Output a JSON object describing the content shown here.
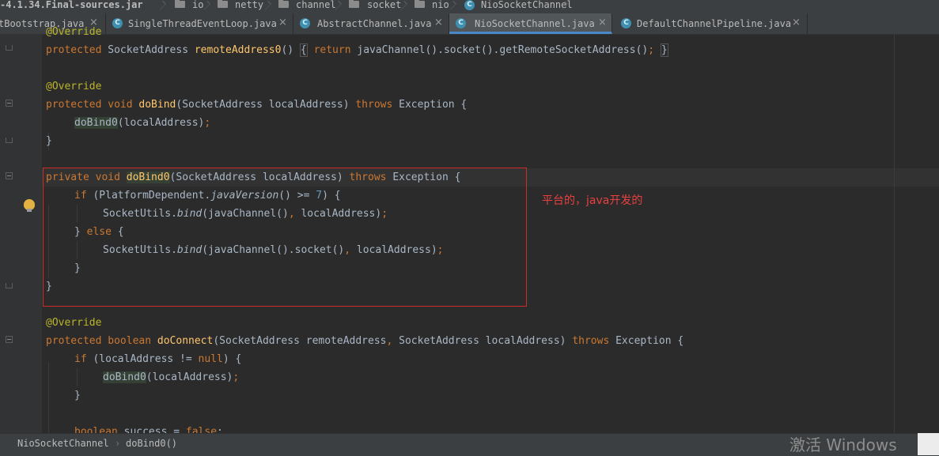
{
  "breadcrumb": {
    "jar": "-4.1.34.Final-sources.jar",
    "items": [
      "io",
      "netty",
      "channel",
      "socket",
      "nio",
      "NioSocketChannel"
    ]
  },
  "tabs": [
    {
      "label": "tBootstrap.java",
      "icon": "class-icon",
      "active": false
    },
    {
      "label": "SingleThreadEventLoop.java",
      "icon": "class-icon",
      "active": false
    },
    {
      "label": "AbstractChannel.java",
      "icon": "class-icon",
      "active": false
    },
    {
      "label": "NioSocketChannel.java",
      "icon": "class-icon",
      "active": true
    },
    {
      "label": "DefaultChannelPipeline.java",
      "icon": "class-icon",
      "active": false
    }
  ],
  "tab_close_glyph": "×",
  "icon_letter": "C",
  "code": {
    "l0": {
      "an": "@Override"
    },
    "l1": {
      "kw1": "protected",
      "t1": " SocketAddress ",
      "fn": "remoteAddress0",
      "t2": "() ",
      "b1": "{",
      "t3": " ",
      "kw2": "return",
      "t4": " javaChannel().socket().getRemoteSocketAddress()",
      "t5": ";",
      "t6": " ",
      "b2": "}"
    },
    "l3": {
      "an": "@Override"
    },
    "l4": {
      "kw1": "protected void",
      "t1": " ",
      "fn": "doBind",
      "t2": "(SocketAddress localAddress) ",
      "kw2": "throws",
      "t3": " Exception {"
    },
    "l5": {
      "t1": "doBind0",
      "t2": "(localAddress)",
      "t3": ";"
    },
    "l6": {
      "t1": "}"
    },
    "l8": {
      "kw1": "private void",
      "t1": " ",
      "fn": "doBind0",
      "t2": "(SocketAddress localAddress) ",
      "kw2": "throws",
      "t3": " Exception {"
    },
    "l9": {
      "kw1": "if",
      "t1": " (PlatformDependent.",
      "it": "javaVersion",
      "t2": "() >= ",
      "num": "7",
      "t3": ") {"
    },
    "l10": {
      "t1": "SocketUtils.",
      "it": "bind",
      "t2": "(javaChannel()",
      "t3": ",",
      "t4": " localAddress)",
      "t5": ";"
    },
    "l11": {
      "t1": "} ",
      "kw1": "else",
      "t2": " {"
    },
    "l12": {
      "t1": "SocketUtils.",
      "it": "bind",
      "t2": "(javaChannel().socket()",
      "t3": ",",
      "t4": " localAddress)",
      "t5": ";"
    },
    "l13": {
      "t1": "}"
    },
    "l14": {
      "t1": "}"
    },
    "l16": {
      "an": "@Override"
    },
    "l17": {
      "kw1": "protected boolean",
      "t1": " ",
      "fn": "doConnect",
      "t2": "(SocketAddress remoteAddress",
      "t3": ",",
      "t4": " SocketAddress localAddress) ",
      "kw2": "throws",
      "t5": " Exception {"
    },
    "l18": {
      "kw1": "if",
      "t1": " (localAddress != ",
      "kw2": "null",
      "t2": ") {"
    },
    "l19": {
      "t1": "doBind0",
      "t2": "(localAddress)",
      "t3": ";"
    },
    "l20": {
      "t1": "}"
    },
    "l22": {
      "kw1": "boolean",
      "t1": " success = ",
      "kw2": "false",
      "t2": ";"
    }
  },
  "annotation_note": "平台的，java开发的",
  "status": {
    "class": "NioSocketChannel",
    "method": "doBind0()",
    "sep": "›"
  },
  "watermark": "激活 Windows",
  "colors": {
    "keyword": "#cc7832",
    "method": "#ffc66d",
    "annotation": "#bbb529",
    "number": "#6897bb",
    "highlight_box": "#d02a2a",
    "note": "#e84040"
  }
}
